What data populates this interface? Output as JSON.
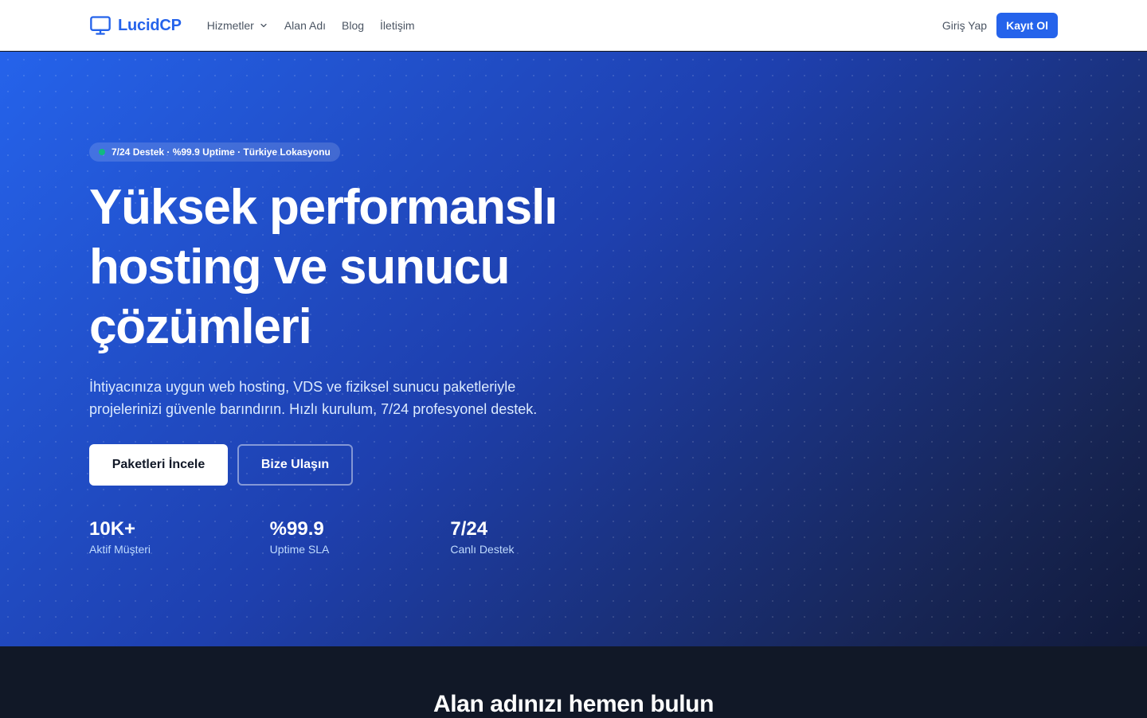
{
  "navbar": {
    "brand": "LucidCP",
    "links": [
      "Hizmetler",
      "Alan Adı",
      "Blog",
      "İletişim"
    ],
    "login": "Giriş Yap",
    "register": "Kayıt Ol"
  },
  "hero": {
    "badge": "7/24 Destek · %99.9 Uptime · Türkiye Lokasyonu",
    "title_lines": [
      "Yüksek performanslı",
      "hosting ve sunucu",
      "çözümleri"
    ],
    "desc_lines": [
      "İhtiyacınıza uygun web hosting, VDS ve fiziksel sunucu paketleriyle",
      "projelerinizi güvenle barındırın. Hızlı kurulum, 7/24 profesyonel destek."
    ],
    "primary_cta": "Paketleri İncele",
    "secondary_cta": "Bize Ulaşın",
    "stats": [
      {
        "value": "10K+",
        "label": "Aktif Müşteri"
      },
      {
        "value": "%99.9",
        "label": "Uptime SLA"
      },
      {
        "value": "7/24",
        "label": "Canlı Destek"
      }
    ]
  },
  "domain": {
    "title": "Alan adınızı hemen bulun"
  },
  "colors": {
    "brand": "#2563eb",
    "status_dot": "#10b981",
    "dark_bg": "#111827"
  }
}
